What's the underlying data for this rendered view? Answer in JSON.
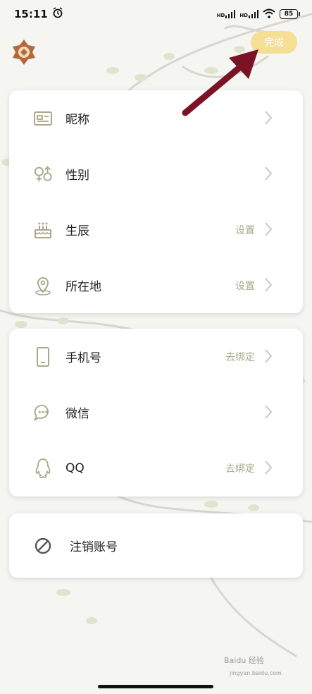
{
  "status_bar": {
    "time": "15:11",
    "battery": "85",
    "hd1": "HD",
    "hd2": "HD"
  },
  "header": {
    "done_label": "完成"
  },
  "profile_section": {
    "items": [
      {
        "label": "昵称",
        "value": "",
        "icon": "id-card-icon"
      },
      {
        "label": "性别",
        "value": "",
        "icon": "gender-icon"
      },
      {
        "label": "生辰",
        "value": "设置",
        "icon": "cake-icon"
      },
      {
        "label": "所在地",
        "value": "设置",
        "icon": "location-pin-icon"
      }
    ]
  },
  "binding_section": {
    "items": [
      {
        "label": "手机号",
        "value": "去绑定",
        "icon": "phone-icon"
      },
      {
        "label": "微信",
        "value": "",
        "icon": "wechat-chat-icon"
      },
      {
        "label": "QQ",
        "value": "去绑定",
        "icon": "qq-penguin-icon"
      }
    ]
  },
  "account_section": {
    "deactivate_label": "注销账号",
    "icon": "ban-icon"
  },
  "watermark": {
    "text": "Baidu 经验",
    "sub": "jingyan.baidu.com"
  },
  "colors": {
    "accent": "#f4df95",
    "icon": "#a7a98a",
    "arrow": "#7a1424"
  }
}
